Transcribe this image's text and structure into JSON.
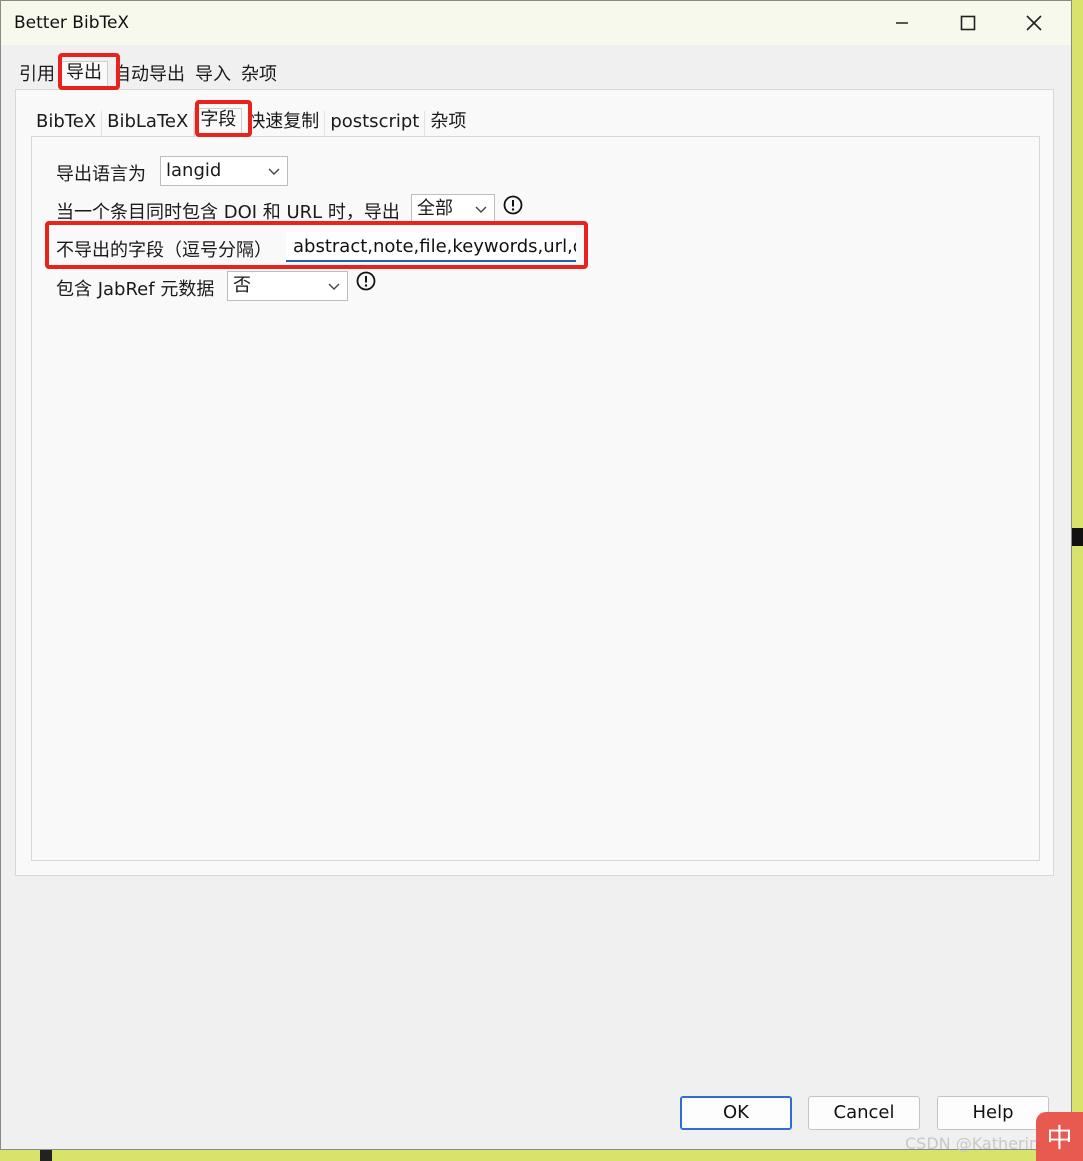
{
  "window": {
    "title": "Better BibTeX"
  },
  "main_tabs": [
    "引用",
    "导出",
    "自动导出",
    "导入",
    "杂项"
  ],
  "main_tabs_active": "导出",
  "sub_tabs": [
    "BibTeX",
    "BibLaTeX",
    "字段",
    "快速复制",
    "postscript",
    "杂项"
  ],
  "sub_tabs_active": "字段",
  "fields": {
    "language_label": "导出语言为",
    "language_value": "langid",
    "doi_url_label": "当一个条目同时包含 DOI 和 URL 时，导出",
    "doi_url_value": "全部",
    "skip_fields_label": "不导出的字段（逗号分隔）",
    "skip_fields_value": "abstract,note,file,keywords,url,dc",
    "jabref_label": "包含 JabRef 元数据",
    "jabref_value": "否"
  },
  "buttons": {
    "ok": "OK",
    "cancel": "Cancel",
    "help": "Help"
  },
  "watermark": "CSDN @Katherine R",
  "ime_indicator": "中",
  "colors": {
    "highlight": "#e8221c",
    "focus_underline": "#1f5fbf",
    "default_button_border": "#2c6fd1"
  }
}
